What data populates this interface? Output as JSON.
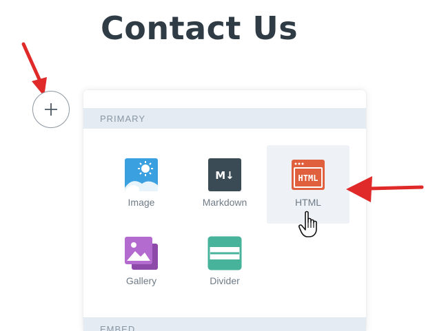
{
  "page": {
    "title": "Contact Us"
  },
  "add_button": {
    "icon": "plus-icon"
  },
  "panel": {
    "sections": [
      {
        "label": "PRIMARY"
      },
      {
        "label": "EMBED"
      }
    ],
    "blocks": [
      {
        "label": "Image",
        "icon": "image-icon",
        "color": "#3aa0e0"
      },
      {
        "label": "Markdown",
        "icon": "markdown-icon",
        "color": "#3b4b56"
      },
      {
        "label": "HTML",
        "icon": "html-icon",
        "color": "#e0603e"
      },
      {
        "label": "Gallery",
        "icon": "gallery-icon",
        "color": "#a85cc4"
      },
      {
        "label": "Divider",
        "icon": "divider-icon",
        "color": "#46b39a"
      }
    ],
    "markdown_glyph": "M↓",
    "html_glyph": "HTML"
  },
  "annotation_color": "#e02a2a"
}
